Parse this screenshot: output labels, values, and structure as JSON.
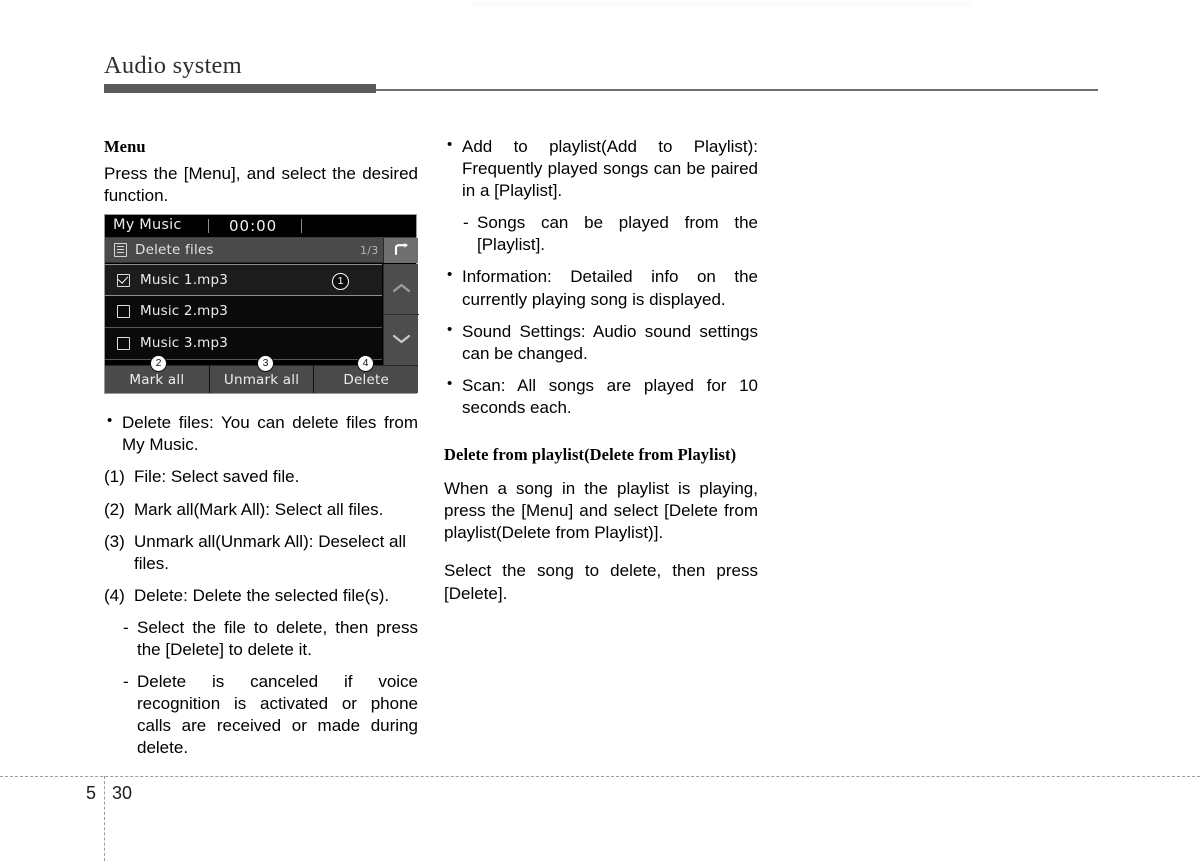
{
  "header": {
    "title": "Audio system"
  },
  "left_column": {
    "section_heading": "Menu",
    "intro": "Press the [Menu], and select the desired function.",
    "bullet_delete_files": "Delete files: You can delete files from My Music.",
    "numbered": [
      {
        "num": "(1)",
        "text": "File: Select saved file."
      },
      {
        "num": "(2)",
        "text": "Mark all(Mark All): Select all files."
      },
      {
        "num": "(3)",
        "text": "Unmark all(Unmark All): Deselect all files."
      },
      {
        "num": "(4)",
        "text": "Delete: Delete the selected file(s)."
      }
    ],
    "dashes": [
      "Select the file to delete, then press the [Delete] to delete it.",
      "Delete is canceled if voice recognition is activated or phone calls are received or made during delete."
    ]
  },
  "right_column": {
    "bullets": [
      "Add to playlist(Add to Playlist): Frequently played songs can be paired in a [Playlist].",
      "Information: Detailed info on the currently playing song is displayed.",
      "Sound Settings: Audio sound settings can be changed.",
      "Scan: All songs are played for 10 seconds each."
    ],
    "dash_after_first_bullet": "Songs can be played from the [Playlist].",
    "section_heading": "Delete from playlist(Delete from Playlist)",
    "paragraph_1": "When a song in the playlist is playing, press the [Menu] and select [Delete from playlist(Delete from Playlist)].",
    "paragraph_2": "Select the song to delete, then press [Delete]."
  },
  "device_screen": {
    "source_label": "My Music",
    "time": "00:00",
    "subtitle": "Delete files",
    "page_indicator": "1/3",
    "back_icon": "back-arrow-icon",
    "scroll_up_icon": "chevron-up-icon",
    "scroll_down_icon": "chevron-down-icon",
    "files": [
      {
        "name": "Music 1.mp3",
        "checked": true
      },
      {
        "name": "Music 2.mp3",
        "checked": false
      },
      {
        "name": "Music 3.mp3",
        "checked": false
      }
    ],
    "actions": [
      {
        "label": "Mark all"
      },
      {
        "label": "Unmark all"
      },
      {
        "label": "Delete"
      }
    ],
    "callouts": [
      {
        "number": "1",
        "style": "dark"
      },
      {
        "number": "2",
        "style": "light"
      },
      {
        "number": "3",
        "style": "light"
      },
      {
        "number": "4",
        "style": "light"
      }
    ]
  },
  "footer": {
    "chapter": "5",
    "page": "30"
  },
  "colors": {
    "rule_dark": "#5b5b5b",
    "device_bar": "#4a4a4a",
    "device_bg": "#000000",
    "back_button": "#6f6f6f"
  }
}
